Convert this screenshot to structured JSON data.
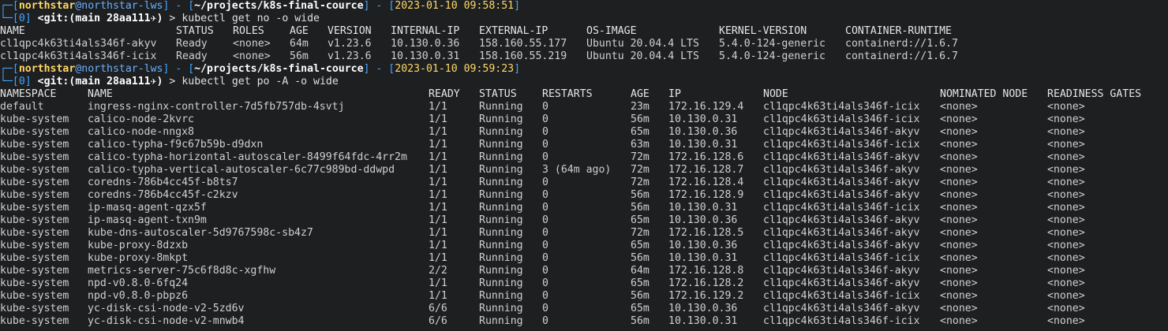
{
  "theme": {
    "background": "#1d1f21",
    "foreground": "#d0d0d0",
    "prompt_bracket": "#3fa7ff",
    "user": "#ffd866",
    "host": "#6ab0ff",
    "path": "#ffffff",
    "timestamp": "#ffd866"
  },
  "prompts": [
    {
      "user": "northstar",
      "at": "@",
      "host": "northstar-lws",
      "path": "~/projects/k8s-final-cource",
      "timestamp": "2023-01-10 09:58:51",
      "index": "[0]",
      "git_label": "<git:(",
      "branch": "main 28aa111",
      "git_close": "✈)",
      "command": "kubectl get no -o wide"
    },
    {
      "user": "northstar",
      "at": "@",
      "host": "northstar-lws",
      "path": "~/projects/k8s-final-cource",
      "timestamp": "2023-01-10 09:59:23",
      "index": "[0]",
      "git_label": "<git:(",
      "branch": "main 28aa111",
      "git_close": "✈)",
      "command": "kubectl get po -A -o wide"
    }
  ],
  "nodes_table": {
    "headers": [
      "NAME",
      "STATUS",
      "ROLES",
      "AGE",
      "VERSION",
      "INTERNAL-IP",
      "EXTERNAL-IP",
      "OS-IMAGE",
      "KERNEL-VERSION",
      "CONTAINER-RUNTIME"
    ],
    "rows": [
      [
        "cl1qpc4k63ti4als346f-akyv",
        "Ready",
        "<none>",
        "64m",
        "v1.23.6",
        "10.130.0.36",
        "158.160.55.177",
        "Ubuntu 20.04.4 LTS",
        "5.4.0-124-generic",
        "containerd://1.6.7"
      ],
      [
        "cl1qpc4k63ti4als346f-icix",
        "Ready",
        "<none>",
        "56m",
        "v1.23.6",
        "10.130.0.31",
        "158.160.55.219",
        "Ubuntu 20.04.4 LTS",
        "5.4.0-124-generic",
        "containerd://1.6.7"
      ]
    ]
  },
  "pods_table": {
    "headers": [
      "NAMESPACE",
      "NAME",
      "READY",
      "STATUS",
      "RESTARTS",
      "AGE",
      "IP",
      "NODE",
      "NOMINATED NODE",
      "READINESS GATES"
    ],
    "rows": [
      [
        "default",
        "ingress-nginx-controller-7d5fb757db-4svtj",
        "1/1",
        "Running",
        "0",
        "23m",
        "172.16.129.4",
        "cl1qpc4k63ti4als346f-icix",
        "<none>",
        "<none>"
      ],
      [
        "kube-system",
        "calico-node-2kvrc",
        "1/1",
        "Running",
        "0",
        "56m",
        "10.130.0.31",
        "cl1qpc4k63ti4als346f-icix",
        "<none>",
        "<none>"
      ],
      [
        "kube-system",
        "calico-node-nngx8",
        "1/1",
        "Running",
        "0",
        "65m",
        "10.130.0.36",
        "cl1qpc4k63ti4als346f-akyv",
        "<none>",
        "<none>"
      ],
      [
        "kube-system",
        "calico-typha-f9c67b59b-d9dxn",
        "1/1",
        "Running",
        "0",
        "63m",
        "10.130.0.31",
        "cl1qpc4k63ti4als346f-icix",
        "<none>",
        "<none>"
      ],
      [
        "kube-system",
        "calico-typha-horizontal-autoscaler-8499f64fdc-4rr2m",
        "1/1",
        "Running",
        "0",
        "72m",
        "172.16.128.6",
        "cl1qpc4k63ti4als346f-akyv",
        "<none>",
        "<none>"
      ],
      [
        "kube-system",
        "calico-typha-vertical-autoscaler-6c77c989bd-ddwpd",
        "1/1",
        "Running",
        "3 (64m ago)",
        "72m",
        "172.16.128.7",
        "cl1qpc4k63ti4als346f-akyv",
        "<none>",
        "<none>"
      ],
      [
        "kube-system",
        "coredns-786b4cc45f-b8ts7",
        "1/1",
        "Running",
        "0",
        "72m",
        "172.16.128.4",
        "cl1qpc4k63ti4als346f-akyv",
        "<none>",
        "<none>"
      ],
      [
        "kube-system",
        "coredns-786b4cc45f-c2kzv",
        "1/1",
        "Running",
        "0",
        "56m",
        "172.16.128.9",
        "cl1qpc4k63ti4als346f-akyv",
        "<none>",
        "<none>"
      ],
      [
        "kube-system",
        "ip-masq-agent-qzx5f",
        "1/1",
        "Running",
        "0",
        "56m",
        "10.130.0.31",
        "cl1qpc4k63ti4als346f-icix",
        "<none>",
        "<none>"
      ],
      [
        "kube-system",
        "ip-masq-agent-txn9m",
        "1/1",
        "Running",
        "0",
        "65m",
        "10.130.0.36",
        "cl1qpc4k63ti4als346f-akyv",
        "<none>",
        "<none>"
      ],
      [
        "kube-system",
        "kube-dns-autoscaler-5d9767598c-sb4z7",
        "1/1",
        "Running",
        "0",
        "72m",
        "172.16.128.5",
        "cl1qpc4k63ti4als346f-akyv",
        "<none>",
        "<none>"
      ],
      [
        "kube-system",
        "kube-proxy-8dzxb",
        "1/1",
        "Running",
        "0",
        "65m",
        "10.130.0.36",
        "cl1qpc4k63ti4als346f-akyv",
        "<none>",
        "<none>"
      ],
      [
        "kube-system",
        "kube-proxy-8mkpt",
        "1/1",
        "Running",
        "0",
        "56m",
        "10.130.0.31",
        "cl1qpc4k63ti4als346f-icix",
        "<none>",
        "<none>"
      ],
      [
        "kube-system",
        "metrics-server-75c6f8d8c-xgfhw",
        "2/2",
        "Running",
        "0",
        "64m",
        "172.16.128.8",
        "cl1qpc4k63ti4als346f-akyv",
        "<none>",
        "<none>"
      ],
      [
        "kube-system",
        "npd-v0.8.0-6fq24",
        "1/1",
        "Running",
        "0",
        "65m",
        "172.16.128.2",
        "cl1qpc4k63ti4als346f-akyv",
        "<none>",
        "<none>"
      ],
      [
        "kube-system",
        "npd-v0.8.0-pbpz6",
        "1/1",
        "Running",
        "0",
        "56m",
        "172.16.129.2",
        "cl1qpc4k63ti4als346f-icix",
        "<none>",
        "<none>"
      ],
      [
        "kube-system",
        "yc-disk-csi-node-v2-5zd6v",
        "6/6",
        "Running",
        "0",
        "65m",
        "10.130.0.36",
        "cl1qpc4k63ti4als346f-akyv",
        "<none>",
        "<none>"
      ],
      [
        "kube-system",
        "yc-disk-csi-node-v2-mnwb4",
        "6/6",
        "Running",
        "0",
        "56m",
        "10.130.0.31",
        "cl1qpc4k63ti4als346f-icix",
        "<none>",
        "<none>"
      ]
    ]
  }
}
